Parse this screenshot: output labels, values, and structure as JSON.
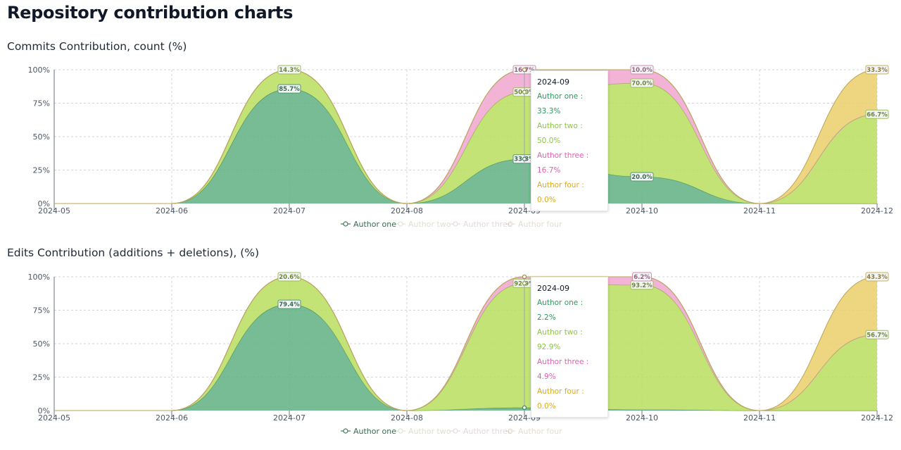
{
  "page": {
    "title": "Repository contribution charts"
  },
  "chart_data": [
    {
      "type": "area",
      "stacked": true,
      "title": "Commits Contribution, count (%)",
      "x": [
        "2024-05",
        "2024-06",
        "2024-07",
        "2024-08",
        "2024-09",
        "2024-10",
        "2024-11",
        "2024-12"
      ],
      "y_ticks": [
        "0%",
        "25%",
        "50%",
        "75%",
        "100%"
      ],
      "ylim": [
        0,
        100
      ],
      "grid": true,
      "series": [
        {
          "name": "Author one",
          "color": "#5fb083",
          "values": [
            0,
            0,
            85.7,
            0,
            33.3,
            20.0,
            0,
            0
          ]
        },
        {
          "name": "Author two",
          "color": "#b9de5f",
          "values": [
            0,
            0,
            14.3,
            0,
            50.0,
            70.0,
            0,
            66.7
          ]
        },
        {
          "name": "Author three",
          "color": "#f0a6cf",
          "values": [
            0,
            0,
            0,
            0,
            16.7,
            10.0,
            0,
            0
          ]
        },
        {
          "name": "Author four",
          "color": "#ebcf6b",
          "values": [
            0,
            0,
            0,
            0,
            0.0,
            0,
            0,
            33.3
          ]
        }
      ],
      "point_labels": [
        {
          "series": 0,
          "index": 2,
          "text": "85.7%"
        },
        {
          "series": 0,
          "index": 4,
          "text": "33.3%"
        },
        {
          "series": 0,
          "index": 5,
          "text": "20.0%"
        },
        {
          "series": 1,
          "index": 2,
          "text": "14.3%"
        },
        {
          "series": 1,
          "index": 4,
          "text": "50.0%"
        },
        {
          "series": 1,
          "index": 5,
          "text": "70.0%"
        },
        {
          "series": 1,
          "index": 7,
          "text": "66.7%"
        },
        {
          "series": 2,
          "index": 4,
          "text": "16.7%"
        },
        {
          "series": 2,
          "index": 5,
          "text": "10.0%"
        },
        {
          "series": 3,
          "index": 7,
          "text": "33.3%"
        }
      ],
      "legend": {
        "placement": "bottom-center",
        "active": "Author one"
      },
      "tooltip": {
        "index": 4,
        "title": "2024-09",
        "rows": [
          {
            "label": "Author one : 33.3%",
            "color": "#2f9a5d"
          },
          {
            "label": "Author two : 50.0%",
            "color": "#8cc63f"
          },
          {
            "label": "Author three : 16.7%",
            "color": "#df5fb0"
          },
          {
            "label": "Author four : 0.0%",
            "color": "#dcaa1e"
          }
        ]
      }
    },
    {
      "type": "area",
      "stacked": true,
      "title": "Edits Contribution (additions + deletions), (%)",
      "x": [
        "2024-05",
        "2024-06",
        "2024-07",
        "2024-08",
        "2024-09",
        "2024-10",
        "2024-11",
        "2024-12"
      ],
      "y_ticks": [
        "0%",
        "25%",
        "50%",
        "75%",
        "100%"
      ],
      "ylim": [
        0,
        100
      ],
      "grid": true,
      "series": [
        {
          "name": "Author one",
          "color": "#5fb083",
          "values": [
            0,
            0,
            79.4,
            0,
            2.2,
            0.6,
            0,
            0
          ]
        },
        {
          "name": "Author two",
          "color": "#b9de5f",
          "values": [
            0,
            0,
            20.6,
            0,
            92.9,
            93.2,
            0,
            56.7
          ]
        },
        {
          "name": "Author three",
          "color": "#f0a6cf",
          "values": [
            0,
            0,
            0,
            0,
            4.9,
            6.2,
            0,
            0
          ]
        },
        {
          "name": "Author four",
          "color": "#ebcf6b",
          "values": [
            0,
            0,
            0,
            0,
            0.0,
            0,
            0,
            43.3
          ]
        }
      ],
      "point_labels": [
        {
          "series": 0,
          "index": 2,
          "text": "79.4%"
        },
        {
          "series": 1,
          "index": 2,
          "text": "20.6%"
        },
        {
          "series": 1,
          "index": 4,
          "text": "92.9%"
        },
        {
          "series": 1,
          "index": 5,
          "text": "93.2%"
        },
        {
          "series": 1,
          "index": 7,
          "text": "56.7%"
        },
        {
          "series": 2,
          "index": 5,
          "text": "6.2%"
        },
        {
          "series": 3,
          "index": 7,
          "text": "43.3%"
        }
      ],
      "legend": {
        "placement": "bottom-center",
        "active": "Author one"
      },
      "tooltip": {
        "index": 4,
        "title": "2024-09",
        "rows": [
          {
            "label": "Author one : 2.2%",
            "color": "#2f9a5d"
          },
          {
            "label": "Author two : 92.9%",
            "color": "#8cc63f"
          },
          {
            "label": "Author three : 4.9%",
            "color": "#df5fb0"
          },
          {
            "label": "Author four : 0.0%",
            "color": "#dcaa1e"
          }
        ]
      }
    }
  ]
}
